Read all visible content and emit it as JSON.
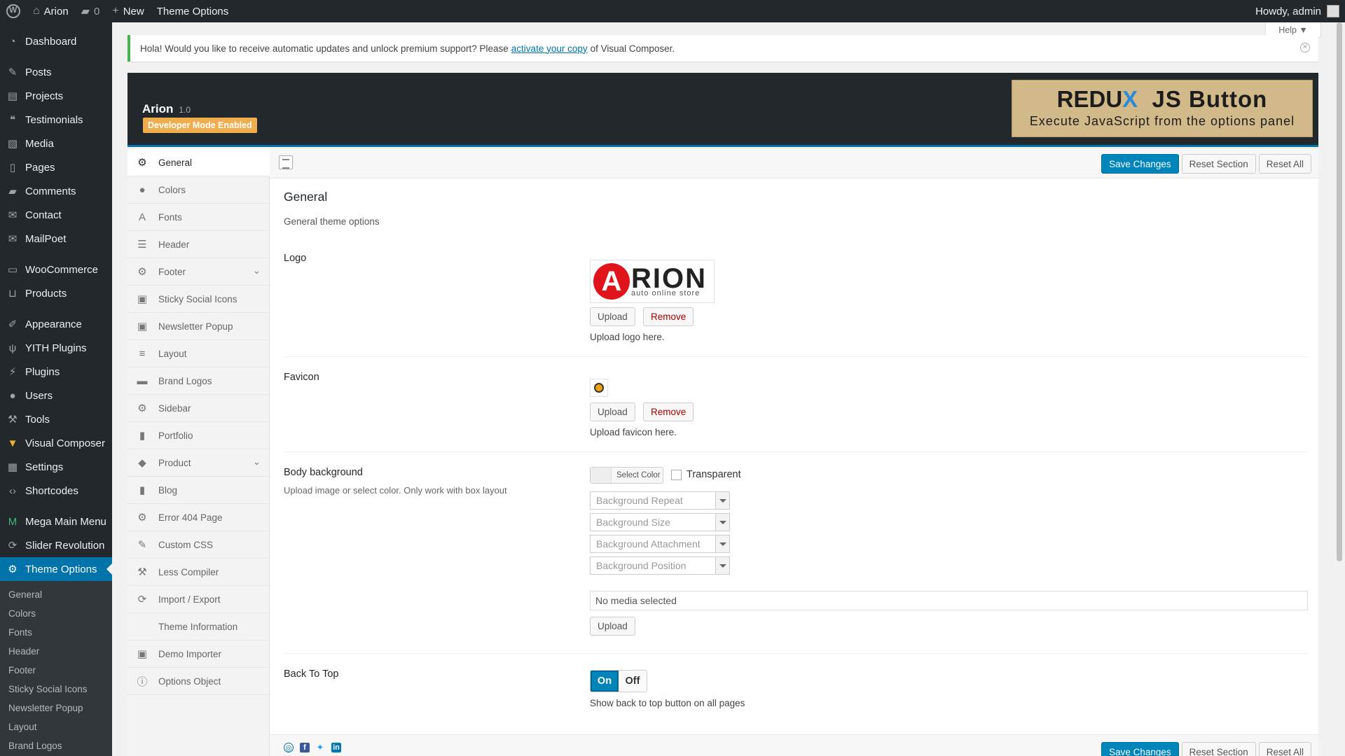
{
  "adminbar": {
    "site_name": "Arion",
    "comments_count": "0",
    "new_label": "New",
    "theme_options_label": "Theme Options",
    "howdy": "Howdy, admin"
  },
  "help_tab": "Help ▼",
  "menu": {
    "items": [
      {
        "label": "Dashboard",
        "icon": "dashboard-icon"
      },
      {
        "label": "Posts",
        "icon": "pin-icon"
      },
      {
        "label": "Projects",
        "icon": "folder-icon"
      },
      {
        "label": "Testimonials",
        "icon": "quote-icon"
      },
      {
        "label": "Media",
        "icon": "media-icon"
      },
      {
        "label": "Pages",
        "icon": "pages-icon"
      },
      {
        "label": "Comments",
        "icon": "comment-icon"
      },
      {
        "label": "Contact",
        "icon": "mail-icon"
      },
      {
        "label": "MailPoet",
        "icon": "mailpoet-icon"
      },
      {
        "label": "WooCommerce",
        "icon": "woo-icon"
      },
      {
        "label": "Products",
        "icon": "cart-icon"
      },
      {
        "label": "Appearance",
        "icon": "brush-icon"
      },
      {
        "label": "YITH Plugins",
        "icon": "yith-icon"
      },
      {
        "label": "Plugins",
        "icon": "plug-icon"
      },
      {
        "label": "Users",
        "icon": "user-icon"
      },
      {
        "label": "Tools",
        "icon": "wrench-icon"
      },
      {
        "label": "Visual Composer",
        "icon": "vc-icon"
      },
      {
        "label": "Settings",
        "icon": "settings-icon"
      },
      {
        "label": "Shortcodes",
        "icon": "code-icon"
      },
      {
        "label": "Mega Main Menu",
        "icon": "megamenu-icon"
      },
      {
        "label": "Slider Revolution",
        "icon": "slider-icon"
      },
      {
        "label": "Theme Options",
        "icon": "gear-icon"
      }
    ],
    "submenu": [
      "General",
      "Colors",
      "Fonts",
      "Header",
      "Footer",
      "Sticky Social Icons",
      "Newsletter Popup",
      "Layout",
      "Brand Logos"
    ]
  },
  "notice": {
    "text_before": "Hola! Would you like to receive automatic updates and unlock premium support? Please",
    "link": "activate your copy",
    "text_after": "of Visual Composer."
  },
  "redux": {
    "title": "Arion",
    "version": "1.0",
    "dev_mode": "Developer Mode Enabled",
    "banner_logo_a": "REDU",
    "banner_logo_b": "X",
    "banner_title": "JS Button",
    "banner_sub": "Execute JavaScript from the options panel"
  },
  "sections": [
    {
      "label": "General",
      "icon": "gear-icon"
    },
    {
      "label": "Colors",
      "icon": "drop-icon"
    },
    {
      "label": "Fonts",
      "icon": "font-icon"
    },
    {
      "label": "Header",
      "icon": "header-icon"
    },
    {
      "label": "Footer",
      "icon": "gear-icon",
      "expandable": true
    },
    {
      "label": "Sticky Social Icons",
      "icon": "window-icon"
    },
    {
      "label": "Newsletter Popup",
      "icon": "window-icon"
    },
    {
      "label": "Layout",
      "icon": "list-icon"
    },
    {
      "label": "Brand Logos",
      "icon": "briefcase-icon"
    },
    {
      "label": "Sidebar",
      "icon": "gear-icon"
    },
    {
      "label": "Portfolio",
      "icon": "bookmark-icon"
    },
    {
      "label": "Product",
      "icon": "tags-icon",
      "expandable": true
    },
    {
      "label": "Blog",
      "icon": "book-icon"
    },
    {
      "label": "Error 404 Page",
      "icon": "gear-icon"
    },
    {
      "label": "Custom CSS",
      "icon": "pencil-icon"
    },
    {
      "label": "Less Compiler",
      "icon": "wrench-icon"
    },
    {
      "label": "Import / Export",
      "icon": "refresh-icon"
    },
    {
      "label": "Theme Information",
      "icon": ""
    },
    {
      "label": "Demo Importer",
      "icon": "window-icon"
    },
    {
      "label": "Options Object",
      "icon": "info-icon"
    }
  ],
  "toolbar": {
    "save": "Save Changes",
    "reset_section": "Reset Section",
    "reset_all": "Reset All"
  },
  "general": {
    "title": "General",
    "description": "General theme options",
    "logo": {
      "label": "Logo",
      "logo_letter": "A",
      "logo_name": "RION",
      "logo_tagline": "auto online store",
      "upload": "Upload",
      "remove": "Remove",
      "help": "Upload logo here."
    },
    "favicon": {
      "label": "Favicon",
      "upload": "Upload",
      "remove": "Remove",
      "help": "Upload favicon here."
    },
    "body_bg": {
      "label": "Body background",
      "sub": "Upload image or select color. Only work with box layout",
      "select_color": "Select Color",
      "transparent": "Transparent",
      "repeat": "Background Repeat",
      "size": "Background Size",
      "attachment": "Background Attachment",
      "position": "Background Position",
      "media": "No media selected",
      "upload": "Upload"
    },
    "back_to_top": {
      "label": "Back To Top",
      "on": "On",
      "off": "Off",
      "help": "Show back to top button on all pages"
    }
  },
  "colors": {
    "accent": "#0073aa",
    "admin_bg": "#23282d",
    "dev_badge": "#f0ad4e",
    "notice_border": "#46b450"
  }
}
